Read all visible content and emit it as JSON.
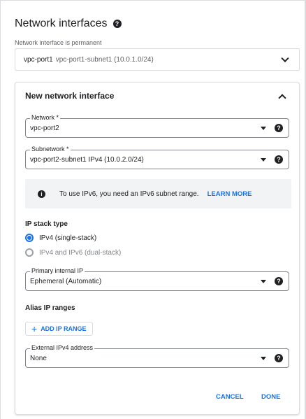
{
  "header": {
    "title": "Network interfaces",
    "help_icon": "help-circle-icon"
  },
  "permanent": {
    "label": "Network interface is permanent",
    "name": "vpc-port1",
    "detail": "vpc-port1-subnet1 (10.0.1.0/24)"
  },
  "new_interface": {
    "title": "New network interface",
    "network": {
      "label": "Network *",
      "value": "vpc-port2"
    },
    "subnetwork": {
      "label": "Subnetwork *",
      "value": "vpc-port2-subnet1 IPv4 (10.0.2.0/24)"
    },
    "info": {
      "text": "To use IPv6, you need an IPv6 subnet range.",
      "link": "LEARN MORE"
    },
    "ip_stack": {
      "label": "IP stack type",
      "options": [
        {
          "label": "IPv4 (single-stack)",
          "selected": true
        },
        {
          "label": "IPv4 and IPv6 (dual-stack)",
          "selected": false
        }
      ]
    },
    "primary_ip": {
      "label": "Primary internal IP",
      "value": "Ephemeral (Automatic)"
    },
    "alias": {
      "label": "Alias IP ranges",
      "add_button": "ADD IP RANGE"
    },
    "external_ip": {
      "label": "External IPv4 address",
      "value": "None"
    },
    "actions": {
      "cancel": "CANCEL",
      "done": "DONE"
    }
  },
  "colors": {
    "accent": "#1a73e8",
    "border": "#dadce0",
    "info_bg": "#f1f3f4"
  }
}
